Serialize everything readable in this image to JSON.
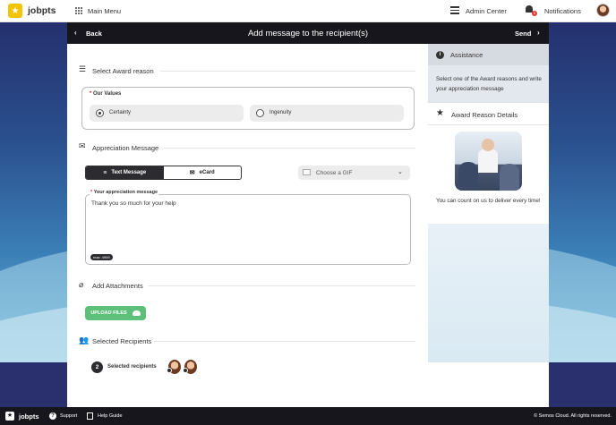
{
  "topbar": {
    "brand": "jobpts",
    "main_menu": "Main Menu",
    "admin_center": "Admin Center",
    "notifications": "Notifications",
    "notification_count": "0"
  },
  "header": {
    "back": "Back",
    "title": "Add message to the recipient(s)",
    "send": "Send"
  },
  "award": {
    "section_title": "Select Award reason",
    "group_label": "Our Values",
    "options": [
      {
        "label": "Certainty",
        "selected": true
      },
      {
        "label": "Ingenuity",
        "selected": false
      }
    ]
  },
  "message": {
    "section_title": "Appreciation Message",
    "tabs": [
      "Text Message",
      "eCard"
    ],
    "active_tab": "Text Message",
    "gif_placeholder": "Choose a GIF",
    "field_label": "Your appreciation message",
    "value": "Thank you so much for your help",
    "max_label": "max: 4969"
  },
  "attachments": {
    "section_title": "Add Attachments",
    "upload_label": "UPLOAD FILES"
  },
  "recipients": {
    "section_title": "Selected Recipients",
    "count": "2",
    "label": "Selected recipients"
  },
  "sidebar": {
    "assistance_title": "Assistance",
    "assistance_text": "Select one of the Award reasons and write your appreciation message",
    "details_title": "Award Reason Details",
    "details_text": "You can count on us to deliver every time!"
  },
  "footer": {
    "brand": "jobpts",
    "support": "Support",
    "help": "Help Guide",
    "copyright": "© Semos Cloud. All rights reserved."
  },
  "colors": {
    "upload_green": "#5cc07a",
    "header_dark": "#16161c",
    "logo_yellow": "#f5c400",
    "required_red": "#d22222"
  }
}
